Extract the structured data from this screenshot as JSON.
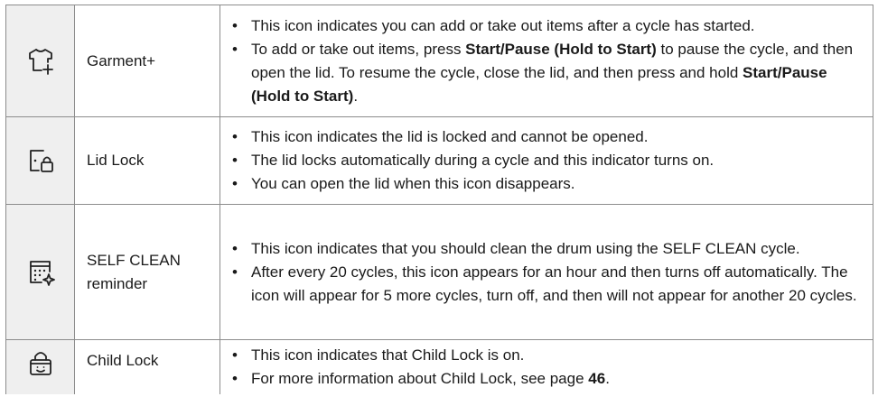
{
  "rows": [
    {
      "icon": "garment-plus-icon",
      "name": "Garment+",
      "bullets": [
        [
          "This icon indicates you can add or take out items after a cycle has started."
        ],
        [
          "To add or take out items, press ",
          {
            "b": "Start/Pause (Hold to Start)"
          },
          " to pause the cycle, and then open the lid. To resume the cycle, close the lid, and then press and hold ",
          {
            "b": "Start/Pause (Hold to Start)"
          },
          "."
        ]
      ]
    },
    {
      "icon": "lid-lock-icon",
      "name": "Lid Lock",
      "bullets": [
        [
          "This icon indicates the lid is locked and cannot be opened."
        ],
        [
          "The lid locks automatically during a cycle and this indicator turns on."
        ],
        [
          "You can open the lid when this icon disappears."
        ]
      ]
    },
    {
      "icon": "self-clean-reminder-icon",
      "name": "SELF CLEAN reminder",
      "bullets": [
        [
          "This icon indicates that you should clean the drum using the SELF CLEAN cycle."
        ],
        [
          "After every 20 cycles, this icon appears for an hour and then turns off automatically. The icon will appear for 5 more cycles, turn off, and then will not appear for another 20 cycles."
        ]
      ]
    },
    {
      "icon": "child-lock-icon",
      "name": "Child Lock",
      "bullets": [
        [
          "This icon indicates that Child Lock is on."
        ],
        [
          "For more information about Child Lock, see page ",
          {
            "b": "46"
          },
          "."
        ]
      ]
    }
  ]
}
